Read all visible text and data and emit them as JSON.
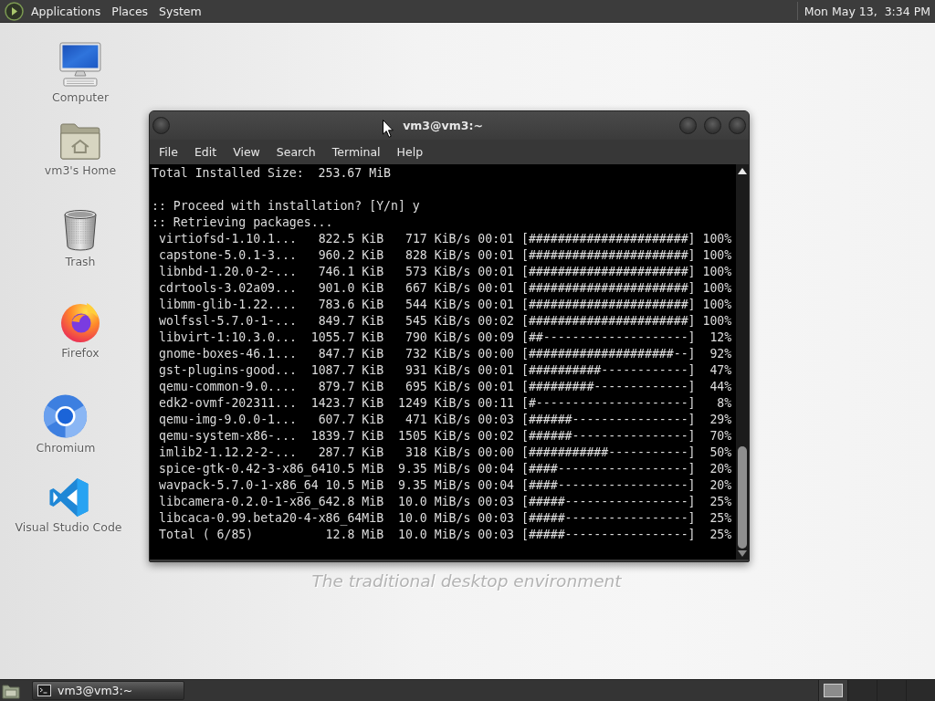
{
  "top_panel": {
    "menus": [
      "Applications",
      "Places",
      "System"
    ],
    "clock": "Mon May 13,  3:34 PM"
  },
  "desktop": {
    "icons": [
      {
        "kind": "computer",
        "label": "Computer"
      },
      {
        "kind": "home",
        "label": "vm3's Home"
      },
      {
        "kind": "trash",
        "label": "Trash"
      },
      {
        "kind": "firefox",
        "label": "Firefox"
      },
      {
        "kind": "chromium",
        "label": "Chromium"
      },
      {
        "kind": "vscode",
        "label": "Visual Studio Code"
      }
    ],
    "wallpaper_caption": "The traditional desktop environment"
  },
  "window": {
    "title": "vm3@vm3:~",
    "menu": [
      "File",
      "Edit",
      "View",
      "Search",
      "Terminal",
      "Help"
    ],
    "terminal": {
      "summary": "Total Installed Size:  253.67 MiB",
      "messages": [
        ":: Proceed with installation? [Y/n] y",
        ":: Retrieving packages..."
      ],
      "downloads": [
        "virtiofsd-1.10.1...   822.5 KiB   717 KiB/s 00:01 [######################] 100%",
        "capstone-5.0.1-3...   960.2 KiB   828 KiB/s 00:01 [######################] 100%",
        "libnbd-1.20.0-2-...   746.1 KiB   573 KiB/s 00:01 [######################] 100%",
        "cdrtools-3.02a09...   901.0 KiB   667 KiB/s 00:01 [######################] 100%",
        "libmm-glib-1.22....   783.6 KiB   544 KiB/s 00:01 [######################] 100%",
        "wolfssl-5.7.0-1-...   849.7 KiB   545 KiB/s 00:02 [######################] 100%",
        "libvirt-1:10.3.0...  1055.7 KiB   790 KiB/s 00:09 [##--------------------]  12%",
        "gnome-boxes-46.1...   847.7 KiB   732 KiB/s 00:00 [####################--]  92%",
        "gst-plugins-good...  1087.7 KiB   931 KiB/s 00:01 [##########------------]  47%",
        "qemu-common-9.0....   879.7 KiB   695 KiB/s 00:01 [#########-------------]  44%",
        "edk2-ovmf-202311...  1423.7 KiB  1249 KiB/s 00:11 [#---------------------]   8%",
        "qemu-img-9.0.0-1...   607.7 KiB   471 KiB/s 00:03 [######----------------]  29%",
        "qemu-system-x86-...  1839.7 KiB  1505 KiB/s 00:02 [######----------------]  70%",
        "imlib2-1.12.2-2-...   287.7 KiB   318 KiB/s 00:00 [###########-----------]  50%",
        "spice-gtk-0.42-3-x86_6410.5 MiB  9.35 MiB/s 00:04 [####------------------]  20%",
        "wavpack-5.7.0-1-x86_64 10.5 MiB  9.35 MiB/s 00:04 [####------------------]  20%",
        "libcamera-0.2.0-1-x86_642.8 MiB  10.0 MiB/s 00:03 [#####-----------------]  25%",
        "libcaca-0.99.beta20-4-x86_64MiB  10.0 MiB/s 00:03 [#####-----------------]  25%"
      ],
      "total": "Total ( 6/85)          12.8 MiB  10.0 MiB/s 00:03 [#####-----------------]  25%"
    }
  },
  "taskbar": {
    "tasks": [
      {
        "label": "vm3@vm3:~"
      }
    ],
    "workspaces": [
      {
        "selected": true
      },
      {
        "selected": false
      },
      {
        "selected": false
      },
      {
        "selected": false
      }
    ]
  }
}
